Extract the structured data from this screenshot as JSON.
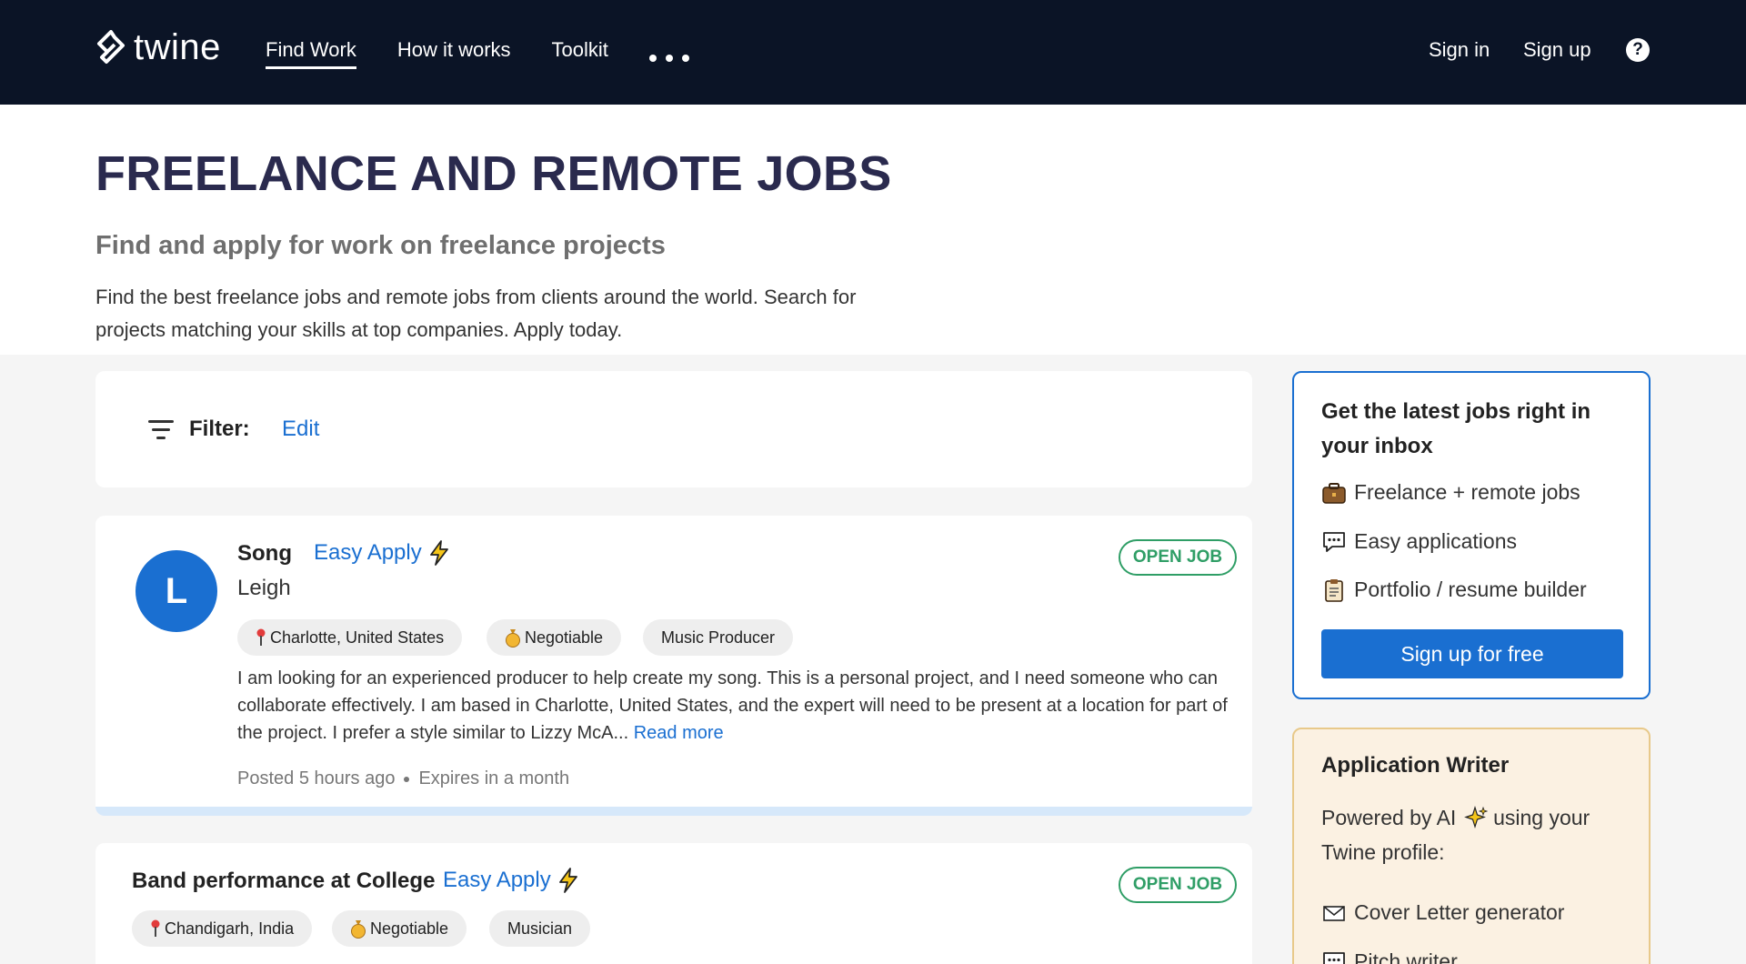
{
  "header": {
    "logo_text": "twine",
    "nav": [
      "Find Work",
      "How it works",
      "Toolkit"
    ],
    "sign_in": "Sign in",
    "sign_up": "Sign up",
    "help_glyph": "?"
  },
  "hero": {
    "title": "FREELANCE AND REMOTE JOBS",
    "subtitle": "Find and apply for work on freelance projects",
    "description": "Find the best freelance jobs and remote jobs from clients around the world. Search for projects matching your skills at top companies. Apply today."
  },
  "filter": {
    "label": "Filter:",
    "edit": "Edit"
  },
  "jobs": [
    {
      "avatar_letter": "L",
      "title": "Song",
      "easy_apply": "Easy Apply",
      "client": "Leigh",
      "status": "OPEN JOB",
      "location": "Charlotte, United States",
      "budget": "Negotiable",
      "role": "Music Producer",
      "description": "I am looking for an experienced producer to help create my song. This is a personal project, and I need someone who can collaborate effectively. I am based in Charlotte, United States, and the expert will need to be present at a location for part of the project. I prefer a style similar to Lizzy McA...",
      "read_more": "Read more",
      "posted": "Posted 5 hours ago",
      "expires": "Expires in a month"
    },
    {
      "title": "Band performance at College",
      "easy_apply": "Easy Apply",
      "status": "OPEN JOB",
      "location": "Chandigarh, India",
      "budget": "Negotiable",
      "role": "Musician"
    }
  ],
  "sidebar": {
    "newsletter": {
      "title": "Get the latest jobs right in your inbox",
      "items": [
        "Freelance + remote jobs",
        "Easy applications",
        "Portfolio / resume builder"
      ],
      "button": "Sign up for free"
    },
    "ai_writer": {
      "title": "Application Writer",
      "desc_before": "Powered by AI",
      "desc_after": "using your Twine profile:",
      "items": [
        "Cover Letter generator",
        "Pitch writer"
      ]
    }
  },
  "colors": {
    "header_bg": "#0b1426",
    "accent": "#1a6fd1",
    "open_green": "#2f9e66",
    "title_navy": "#2a2a4e"
  }
}
